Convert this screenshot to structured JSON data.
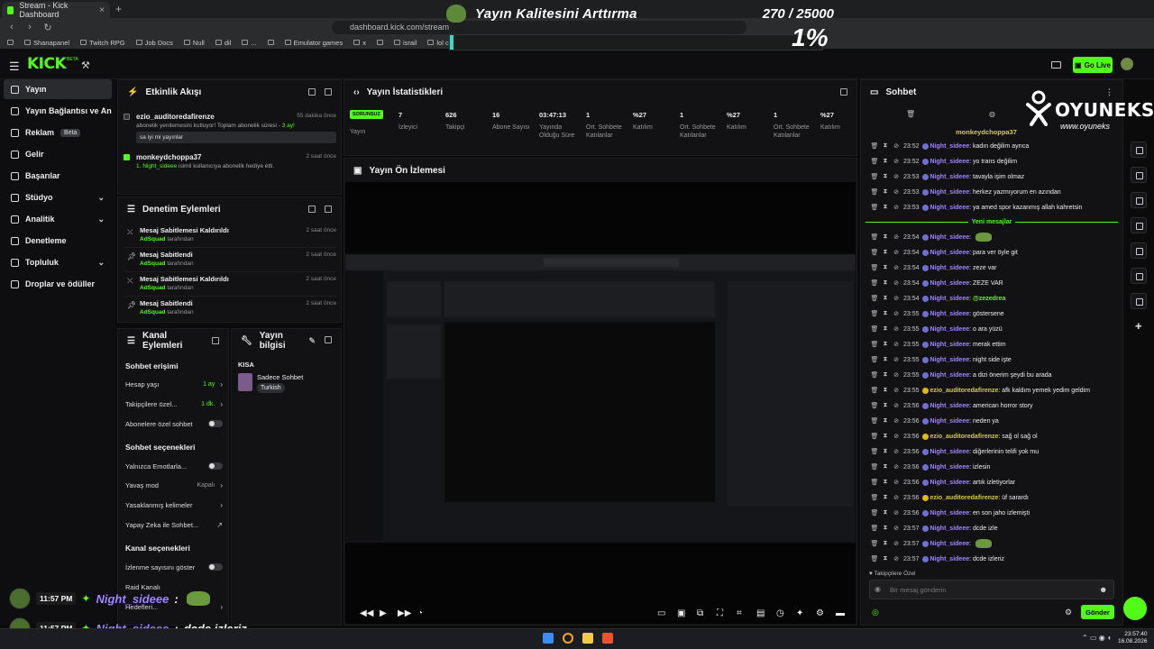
{
  "browser": {
    "tab_title": "Stream - Kick Dashboard",
    "url": "dashboard.kick.com/stream",
    "bookmarks": [
      "Shanapanel",
      "Twitch RPG",
      "Job Docs",
      "Null",
      "dil",
      "...",
      "",
      "Emulator games",
      "x",
      "",
      "israil",
      "lol classic"
    ]
  },
  "overlay": {
    "goal_title": "Yayın Kalitesini Arttırma",
    "goal_count": "270 / 25000",
    "goal_percent": "1%",
    "goal_progress": 0.0108
  },
  "header": {
    "logo": "KICK",
    "logo_badge": "BETA",
    "go_live": "Go Live"
  },
  "sidebar": {
    "items": [
      {
        "label": "Yayın",
        "active": true
      },
      {
        "label": "Yayın Bağlantısı ve Anahtarı",
        "active": false
      },
      {
        "label": "Reklam",
        "badge": "Beta"
      },
      {
        "label": "Gelir"
      },
      {
        "label": "Başarılar"
      },
      {
        "label": "Stüdyo",
        "chevron": true
      },
      {
        "label": "Analitik",
        "chevron": true
      },
      {
        "label": "Denetleme"
      },
      {
        "label": "Topluluk",
        "chevron": true
      },
      {
        "label": "Droplar ve ödüller"
      }
    ]
  },
  "activity": {
    "title": "Etkinlik Akışı",
    "items": [
      {
        "user": "ezio_auditoredafirenze",
        "time": "55 dakika önce",
        "message": "abonelik yenilemesini kutluyor! Toplam abonelik süresi - ",
        "months": "3 ay!",
        "quote": "sa iyi mi yayınlar"
      },
      {
        "user": "monkeydchoppa37",
        "time": "2 saat önce",
        "count": "1.",
        "gift_target": "Night_sideee",
        "message": " isimli kullanıcıya abonelik hediye etti."
      }
    ]
  },
  "mod_actions": {
    "title": "Denetim Eylemleri",
    "by_suffix": "tarafından",
    "items": [
      {
        "action": "Mesaj Sabitlemesi Kaldırıldı",
        "by": "AdSquad",
        "time": "2 saat önce"
      },
      {
        "action": "Mesaj Sabitlendi",
        "by": "AdSquad",
        "time": "2 saat önce"
      },
      {
        "action": "Mesaj Sabitlemesi Kaldırıldı",
        "by": "AdSquad",
        "time": "2 saat önce"
      },
      {
        "action": "Mesaj Sabitlendi",
        "by": "AdSquad",
        "time": "2 saat önce"
      }
    ]
  },
  "channel_actions": {
    "title": "Kanal Eylemleri",
    "section_chat_access": "Sohbet erişimi",
    "account_age_label": "Hesap yaşı",
    "account_age_value": "1 ay",
    "followers_only_label": "Takipçilere özel...",
    "followers_only_value": "1 dk.",
    "subs_only_label": "Abonelere özel sohbet",
    "section_chat_options": "Sohbet seçenekleri",
    "emotes_only_label": "Yalnızca Emotlarla...",
    "slow_mode_label": "Yavaş mod",
    "slow_mode_value": "Kapalı",
    "banned_words_label": "Yasaklanmış kelimeler",
    "ai_label": "Yapay Zeka ile Sohbet...",
    "section_channel_options": "Kanal seçenekleri",
    "show_viewers_label": "İzlenme sayısını göster",
    "raid_label": "Raid Kanalı",
    "goals_label": "Hedefleri..."
  },
  "stream_info": {
    "title": "Yayın bilgisi",
    "short_label": "KISA",
    "category": "Sadece Sohbet",
    "tag": "Turkish"
  },
  "stats": {
    "title": "Yayın İstatistikleri",
    "badge": "SORUNSUZ",
    "items": [
      {
        "value": "",
        "label": "Yayın"
      },
      {
        "value": "7",
        "label": "İzleyici"
      },
      {
        "value": "626",
        "label": "Takipçi"
      },
      {
        "value": "16",
        "label": "Abone Sayısı"
      },
      {
        "value": "03:47:13",
        "label": "Yayında Olduğu Süre"
      },
      {
        "value": "1",
        "label": "Ort. Sohbete Katılanlar"
      },
      {
        "value": "%27",
        "label": "Katılım"
      },
      {
        "value": "1",
        "label": "Ort. Sohbete Katılanlar"
      },
      {
        "value": "%27",
        "label": "Katılım"
      },
      {
        "value": "1",
        "label": "Ort. Sohbete Katılanlar"
      },
      {
        "value": "%27",
        "label": "Katılım"
      }
    ]
  },
  "preview": {
    "title": "Yayın Ön İzlemesi"
  },
  "chat": {
    "title": "Sohbet",
    "pinned_user": "monkeydchoppa37",
    "new_messages": "Yeni mesajlar",
    "followers_only_notice": "Takipçilere Özel",
    "input_placeholder": "Bir mesaj gönderin",
    "send_label": "Gönder",
    "messages_before": [
      {
        "time": "23:52",
        "user": "Night_sideee",
        "text": "kadın değilim ayrıca"
      },
      {
        "time": "23:52",
        "user": "Night_sideee",
        "text": "yo trans değilim"
      },
      {
        "time": "23:53",
        "user": "Night_sideee",
        "text": "tavayla işim olmaz"
      },
      {
        "time": "23:53",
        "user": "Night_sideee",
        "text": "herkez yazmıyorum en azından"
      },
      {
        "time": "23:53",
        "user": "Night_sideee",
        "text": "ya amed spor kazanmış allah kahretsin"
      }
    ],
    "messages_after": [
      {
        "time": "23:54",
        "user": "Night_sideee",
        "text": "",
        "emote": true
      },
      {
        "time": "23:54",
        "user": "Night_sideee",
        "text": "para ver öyle git"
      },
      {
        "time": "23:54",
        "user": "Night_sideee",
        "text": "zeze var"
      },
      {
        "time": "23:54",
        "user": "Night_sideee",
        "text": "ZEZE VAR"
      },
      {
        "time": "23:54",
        "user": "Night_sideee",
        "text": "@zezedrea",
        "mention": true
      },
      {
        "time": "23:55",
        "user": "Night_sideee",
        "text": "göstersene"
      },
      {
        "time": "23:55",
        "user": "Night_sideee",
        "text": "o ara yüzü"
      },
      {
        "time": "23:55",
        "user": "Night_sideee",
        "text": "merak ettim"
      },
      {
        "time": "23:55",
        "user": "Night_sideee",
        "text": "night side işte"
      },
      {
        "time": "23:55",
        "user": "Night_sideee",
        "text": "a dizi önerim şeydi bu arada"
      },
      {
        "time": "23:55",
        "user": "ezio_auditoredafirenze",
        "text": "afk kaldım yemek yedim geldim",
        "gold": true
      },
      {
        "time": "23:56",
        "user": "Night_sideee",
        "text": "american horror story"
      },
      {
        "time": "23:56",
        "user": "Night_sideee",
        "text": "neden ya"
      },
      {
        "time": "23:56",
        "user": "ezio_auditoredafirenze",
        "text": "sağ ol sağ ol",
        "gold": true
      },
      {
        "time": "23:56",
        "user": "Night_sideee",
        "text": "diğerlerinin telifi yok mu"
      },
      {
        "time": "23:56",
        "user": "Night_sideee",
        "text": "izlesin"
      },
      {
        "time": "23:56",
        "user": "Night_sideee",
        "text": "artık izletiyorlar"
      },
      {
        "time": "23:56",
        "user": "ezio_auditoredafirenze",
        "text": "üf sarardı",
        "gold": true
      },
      {
        "time": "23:56",
        "user": "Night_sideee",
        "text": "en son jaho izlemişti"
      },
      {
        "time": "23:57",
        "user": "Night_sideee",
        "text": "dcde izle"
      },
      {
        "time": "23:57",
        "user": "Night_sideee",
        "text": "",
        "emote": true
      },
      {
        "time": "23:57",
        "user": "Night_sideee",
        "text": "dcde izleriz"
      }
    ]
  },
  "brand": {
    "name": "OYUNEKS",
    "site": "www.oyuneks"
  },
  "overlay_chat": [
    {
      "time": "11:57 PM",
      "user": "Night_sideee",
      "sep": " :",
      "text": "",
      "emote": true
    },
    {
      "time": "11:57 PM",
      "user": "Night_sideee",
      "sep": " :",
      "text": "dcde izleriz"
    }
  ],
  "taskbar": {
    "time": "23:57:40",
    "date": "16.08.2026"
  },
  "colors": {
    "accent": "#53fc18",
    "chat_user": "#9f86ff",
    "gold_user": "#d8c94b",
    "panel_bg": "#121214"
  }
}
